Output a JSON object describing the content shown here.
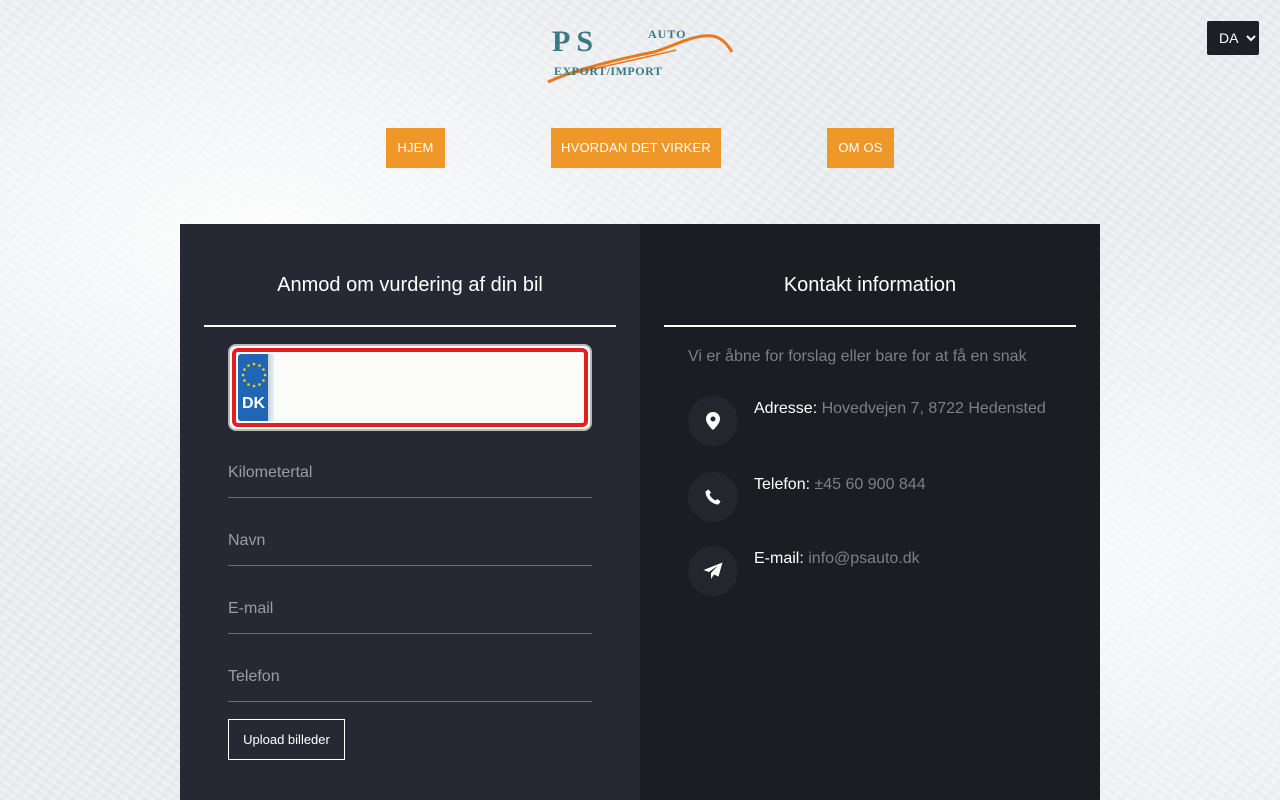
{
  "language": {
    "selected": "DA",
    "options": [
      "DA"
    ]
  },
  "logo": {
    "brand": "PS",
    "tag_top": "AUTO",
    "tag_bottom": "EXPORT/IMPORT"
  },
  "nav": {
    "home": "HJEM",
    "how_it_works": "HVORDAN DET VIRKER",
    "about": "OM OS"
  },
  "form": {
    "title": "Anmod om vurdering af din bil",
    "plate_country": "DK",
    "plate_value": "",
    "mileage_placeholder": "Kilometertal",
    "name_placeholder": "Navn",
    "email_placeholder": "E-mail",
    "phone_placeholder": "Telefon",
    "upload_label": "Upload billeder"
  },
  "contact": {
    "title": "Kontakt information",
    "intro": "Vi er åbne for forslag eller bare for at få en snak",
    "address_label": "Adresse:",
    "address_value": "Hovedvejen 7, 8722 Hedensted",
    "phone_label": "Telefon:",
    "phone_value": "±45 60 900 844",
    "email_label": "E-mail:",
    "email_value": "info@psauto.dk"
  },
  "colors": {
    "accent": "#f0972a",
    "panel_left": "#262833",
    "panel_right": "#1c1d23",
    "plate_border": "#e02020",
    "eu_blue": "#1f66b5"
  }
}
